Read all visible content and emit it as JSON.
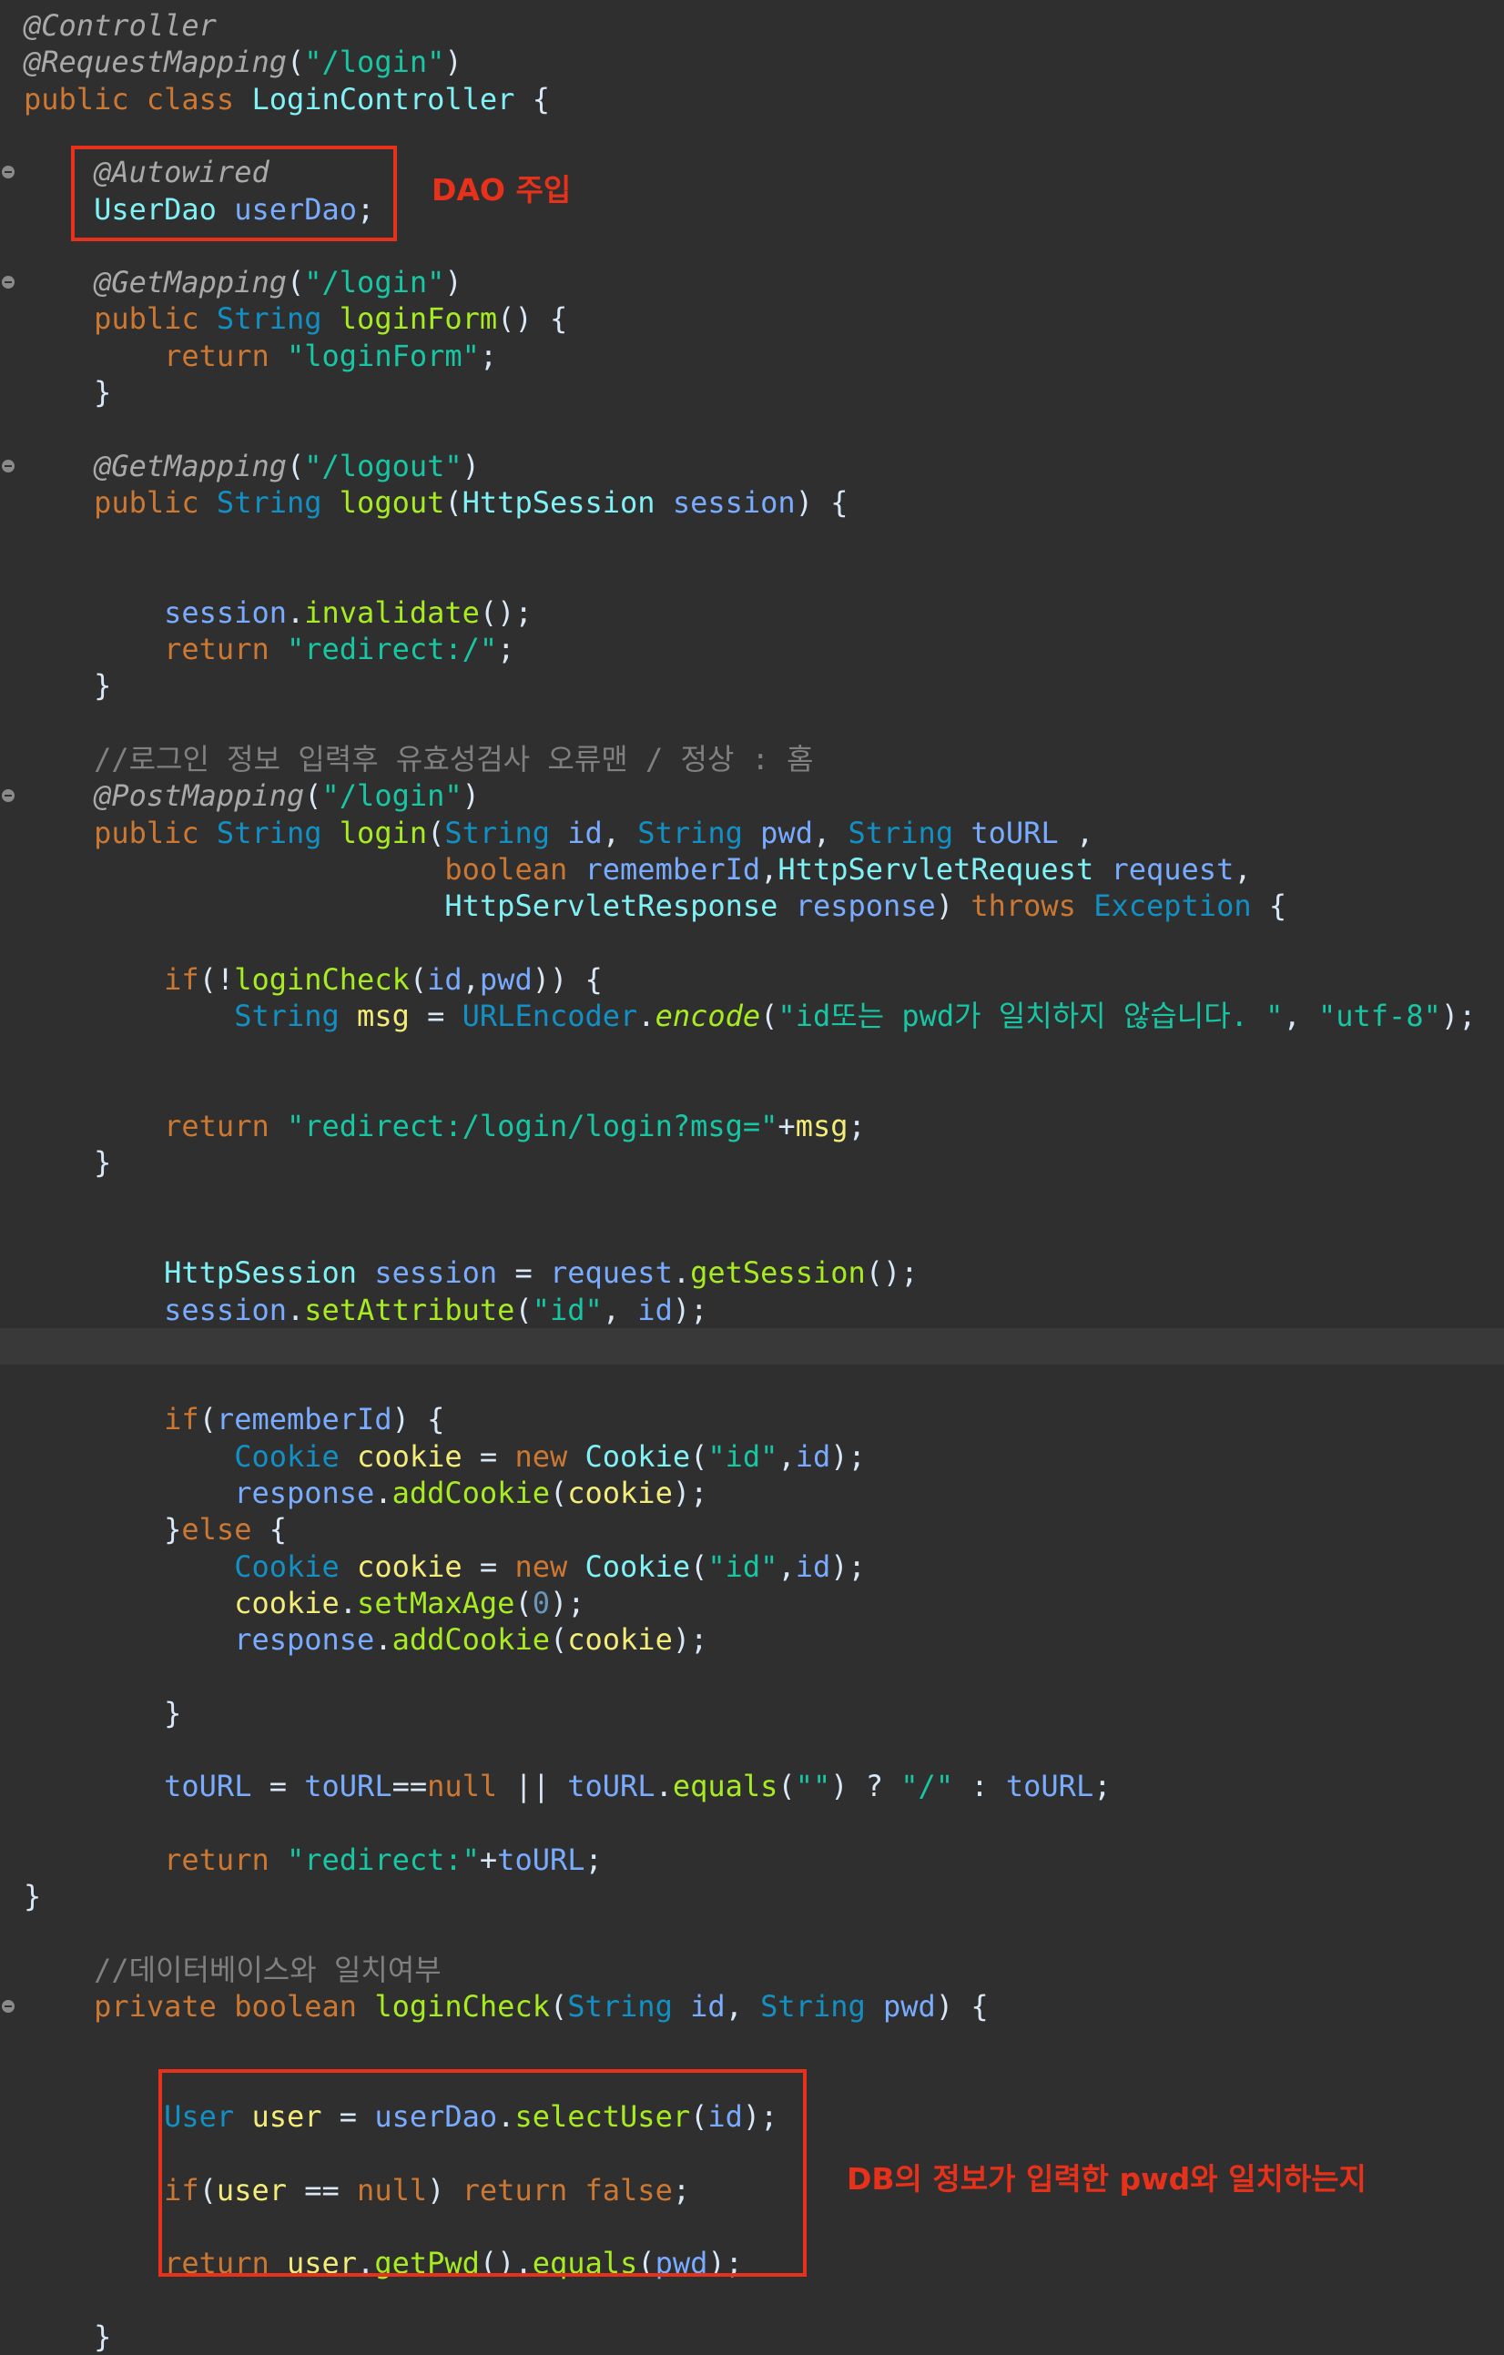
{
  "code_lines": [
    {
      "text": "@Controller"
    },
    {
      "text": "@RequestMapping(\"/login\")"
    },
    {
      "text": "public class LoginController {"
    },
    {
      "text": ""
    },
    {
      "text": "    @Autowired",
      "fold": true
    },
    {
      "text": "    UserDao userDao;"
    },
    {
      "text": ""
    },
    {
      "text": "    @GetMapping(\"/login\")",
      "fold": true
    },
    {
      "text": "    public String loginForm() {"
    },
    {
      "text": "        return \"loginForm\";"
    },
    {
      "text": "    }"
    },
    {
      "text": ""
    },
    {
      "text": "    @GetMapping(\"/logout\")",
      "fold": true
    },
    {
      "text": "    public String logout(HttpSession session) {"
    },
    {
      "text": ""
    },
    {
      "text": ""
    },
    {
      "text": "        session.invalidate();"
    },
    {
      "text": "        return \"redirect:/\";"
    },
    {
      "text": "    }"
    },
    {
      "text": ""
    },
    {
      "text": "    //로그인 정보 입력후 유효성검사 오류맨 / 정상 : 홈"
    },
    {
      "text": "    @PostMapping(\"/login\")",
      "fold": true
    },
    {
      "text": "    public String login(String id, String pwd, String toURL ,"
    },
    {
      "text": "                        boolean rememberId,HttpServletRequest request,"
    },
    {
      "text": "                        HttpServletResponse response) throws Exception {"
    },
    {
      "text": ""
    },
    {
      "text": "        if(!loginCheck(id,pwd)) {"
    },
    {
      "text": "            String msg = URLEncoder.encode(\"id또는 pwd가 일치하지 않습니다. \", \"utf-8\");"
    },
    {
      "text": ""
    },
    {
      "text": ""
    },
    {
      "text": "        return \"redirect:/login/login?msg=\"+msg;"
    },
    {
      "text": "    }"
    },
    {
      "text": ""
    },
    {
      "text": ""
    },
    {
      "text": "        HttpSession session = request.getSession();"
    },
    {
      "text": "        session.setAttribute(\"id\", id);"
    },
    {
      "text": "",
      "current": true
    },
    {
      "text": ""
    },
    {
      "text": "        if(rememberId) {"
    },
    {
      "text": "            Cookie cookie = new Cookie(\"id\",id);"
    },
    {
      "text": "            response.addCookie(cookie);"
    },
    {
      "text": "        }else {"
    },
    {
      "text": "            Cookie cookie = new Cookie(\"id\",id);"
    },
    {
      "text": "            cookie.setMaxAge(0);"
    },
    {
      "text": "            response.addCookie(cookie);"
    },
    {
      "text": ""
    },
    {
      "text": "        }"
    },
    {
      "text": ""
    },
    {
      "text": "        toURL = toURL==null || toURL.equals(\"\") ? \"/\" : toURL;"
    },
    {
      "text": ""
    },
    {
      "text": "        return \"redirect:\"+toURL;"
    },
    {
      "text": "}"
    },
    {
      "text": ""
    },
    {
      "text": "    //데이터베이스와 일치여부"
    },
    {
      "text": "    private boolean loginCheck(String id, String pwd) {",
      "fold": true
    },
    {
      "text": ""
    },
    {
      "text": ""
    },
    {
      "text": "        User user = userDao.selectUser(id);"
    },
    {
      "text": ""
    },
    {
      "text": "        if(user == null) return false;"
    },
    {
      "text": ""
    },
    {
      "text": "        return user.getPwd().equals(pwd);"
    },
    {
      "text": ""
    },
    {
      "text": "    }"
    }
  ],
  "annotations": {
    "dao_note": "DAO 주입",
    "db_note": "DB의 정보가 입력한 pwd와 일치하는지"
  },
  "colors": {
    "background": "#2f2f2f",
    "highlight_box": "#e8311a",
    "keyword": "#cc7832",
    "string": "#17c6a3",
    "class": "#1290c3",
    "method": "#a7ec21",
    "field": "#79abff",
    "local": "#f3ec79",
    "comment": "#808080"
  }
}
